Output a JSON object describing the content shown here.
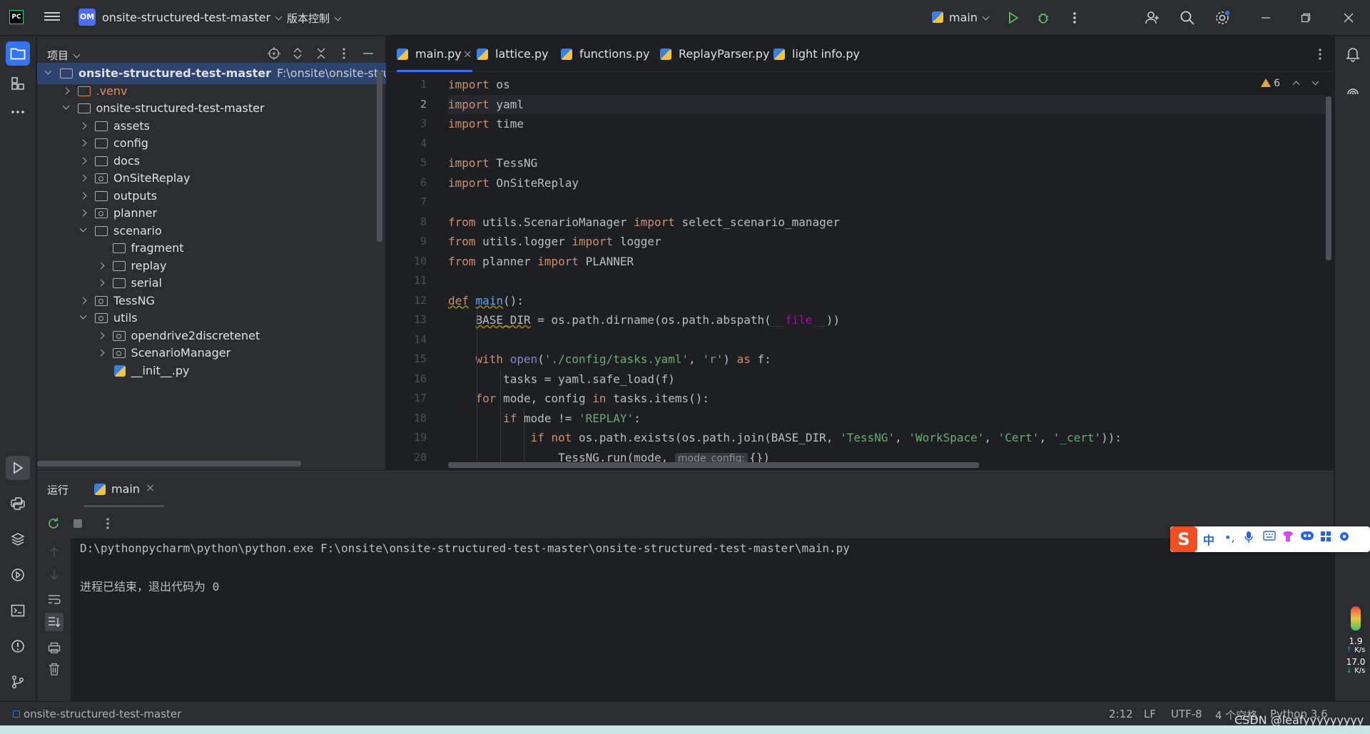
{
  "titlebar": {
    "logo": "PC",
    "project_badge": "OM",
    "project_name": "onsite-structured-test-master",
    "vcs_label": "版本控制",
    "run_config": "main"
  },
  "project_panel": {
    "title": "项目",
    "tree": [
      {
        "label": "onsite-structured-test-master",
        "path": "F:\\onsite\\onsite-structured",
        "level": 0,
        "state": "open",
        "kind": "folder",
        "selected": true,
        "bold": true
      },
      {
        "label": ".venv",
        "level": 1,
        "state": "closed",
        "kind": "venv"
      },
      {
        "label": "onsite-structured-test-master",
        "level": 1,
        "state": "open",
        "kind": "folder"
      },
      {
        "label": "assets",
        "level": 2,
        "state": "closed",
        "kind": "folder"
      },
      {
        "label": "config",
        "level": 2,
        "state": "closed",
        "kind": "folder"
      },
      {
        "label": "docs",
        "level": 2,
        "state": "closed",
        "kind": "folder"
      },
      {
        "label": "OnSiteReplay",
        "level": 2,
        "state": "closed",
        "kind": "pkg"
      },
      {
        "label": "outputs",
        "level": 2,
        "state": "closed",
        "kind": "folder"
      },
      {
        "label": "planner",
        "level": 2,
        "state": "closed",
        "kind": "pkg"
      },
      {
        "label": "scenario",
        "level": 2,
        "state": "open",
        "kind": "folder"
      },
      {
        "label": "fragment",
        "level": 3,
        "state": "none",
        "kind": "folder"
      },
      {
        "label": "replay",
        "level": 3,
        "state": "closed",
        "kind": "folder"
      },
      {
        "label": "serial",
        "level": 3,
        "state": "closed",
        "kind": "folder"
      },
      {
        "label": "TessNG",
        "level": 2,
        "state": "closed",
        "kind": "pkg"
      },
      {
        "label": "utils",
        "level": 2,
        "state": "open",
        "kind": "pkg"
      },
      {
        "label": "opendrive2discretenet",
        "level": 3,
        "state": "closed",
        "kind": "pkg"
      },
      {
        "label": "ScenarioManager",
        "level": 3,
        "state": "closed",
        "kind": "pkg"
      },
      {
        "label": "__init__.py",
        "level": 3,
        "state": "none",
        "kind": "py"
      }
    ]
  },
  "editor": {
    "tabs": [
      {
        "label": "main.py",
        "active": true,
        "closable": true
      },
      {
        "label": "lattice.py"
      },
      {
        "label": "functions.py"
      },
      {
        "label": "ReplayParser.py"
      },
      {
        "label": "light info.py"
      }
    ],
    "inspection_count": "6",
    "current_line": 2,
    "lines": [
      [
        [
          "kw",
          "import"
        ],
        [
          "t",
          " os"
        ]
      ],
      [
        [
          "kw",
          "import"
        ],
        [
          "t",
          " yaml"
        ]
      ],
      [
        [
          "kw",
          "import"
        ],
        [
          "t",
          " time"
        ]
      ],
      [],
      [
        [
          "kw",
          "import"
        ],
        [
          "t",
          " TessNG"
        ]
      ],
      [
        [
          "kw",
          "import"
        ],
        [
          "t",
          " OnSiteReplay"
        ]
      ],
      [],
      [
        [
          "kw",
          "from"
        ],
        [
          "t",
          " utils.ScenarioManager "
        ],
        [
          "kw",
          "import"
        ],
        [
          "t",
          " select_scenario_manager"
        ]
      ],
      [
        [
          "kw",
          "from"
        ],
        [
          "t",
          " utils.logger "
        ],
        [
          "kw",
          "import"
        ],
        [
          "t",
          " logger"
        ]
      ],
      [
        [
          "kw",
          "from"
        ],
        [
          "t",
          " planner "
        ],
        [
          "kw",
          "import"
        ],
        [
          "t",
          " PLANNER"
        ]
      ],
      [],
      [
        [
          "kwu",
          "def"
        ],
        [
          "t",
          " "
        ],
        [
          "fnu",
          "main"
        ],
        [
          "t",
          "():"
        ]
      ],
      [
        [
          "t",
          "    "
        ],
        [
          "ul",
          "BASE_DIR"
        ],
        [
          "t",
          " = os.path.dirname(os.path.abspath("
        ],
        [
          "sf",
          "__file__"
        ],
        [
          "t",
          "))"
        ]
      ],
      [],
      [
        [
          "t",
          "    "
        ],
        [
          "kw",
          "with"
        ],
        [
          "t",
          " "
        ],
        [
          "bi",
          "open"
        ],
        [
          "t",
          "("
        ],
        [
          "st",
          "'./config/tasks.yaml'"
        ],
        [
          "t",
          ", "
        ],
        [
          "st",
          "'r'"
        ],
        [
          "t",
          ") "
        ],
        [
          "kw",
          "as"
        ],
        [
          "t",
          " f:"
        ]
      ],
      [
        [
          "t",
          "        tasks = yaml.safe_load(f)"
        ]
      ],
      [
        [
          "t",
          "    "
        ],
        [
          "kw",
          "for"
        ],
        [
          "t",
          " mode, config "
        ],
        [
          "kw",
          "in"
        ],
        [
          "t",
          " tasks.items():"
        ]
      ],
      [
        [
          "t",
          "        "
        ],
        [
          "kw",
          "if"
        ],
        [
          "t",
          " mode != "
        ],
        [
          "st",
          "'REPLAY'"
        ],
        [
          "t",
          ":"
        ]
      ],
      [
        [
          "t",
          "            "
        ],
        [
          "kw",
          "if not"
        ],
        [
          "t",
          " os.path.exists(os.path.join(BASE_DIR, "
        ],
        [
          "st",
          "'TessNG'"
        ],
        [
          "t",
          ", "
        ],
        [
          "st",
          "'WorkSpace'"
        ],
        [
          "t",
          ", "
        ],
        [
          "st",
          "'Cert'"
        ],
        [
          "t",
          ", "
        ],
        [
          "st",
          "'_cert'"
        ],
        [
          "t",
          "))"
        ],
        [
          "t",
          ":"
        ]
      ],
      [
        [
          "t",
          "                TessNG.run(mode, "
        ],
        [
          "hint",
          "mode_config:"
        ],
        [
          "t",
          "{})"
        ]
      ]
    ]
  },
  "run_panel": {
    "title": "运行",
    "tab_label": "main",
    "console": [
      "D:\\pythonpycharm\\python\\python.exe F:\\onsite\\onsite-structured-test-master\\onsite-structured-test-master\\main.py",
      "",
      "进程已结束，退出代码为 0"
    ]
  },
  "statusbar": {
    "project": "onsite-structured-test-master",
    "position": "2:12",
    "line_sep": "LF",
    "encoding": "UTF-8",
    "indent": "4 个空格",
    "interpreter": "Python 3.6"
  },
  "overlay": {
    "ime_logo": "S",
    "ime_lang": "中",
    "net_up": "1.9",
    "net_up_unit": "K/s",
    "net_down": "17.0",
    "net_down_unit": "K/s",
    "watermark": "CSDN @leafyyyyyyyyy"
  },
  "colors": {
    "accent": "#3574f0",
    "keyword": "#cf8e6d",
    "string": "#6aab73",
    "function": "#56a8f5",
    "background": "#1e1f22",
    "panel": "#2b2d30"
  }
}
